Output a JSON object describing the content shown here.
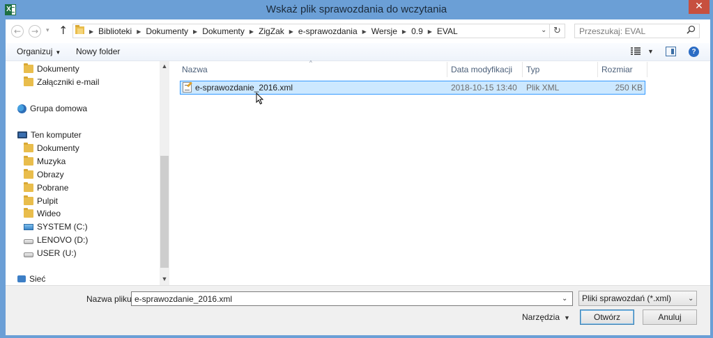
{
  "window": {
    "title": "Wskaż plik sprawozdania do wczytania",
    "close_glyph": "✕",
    "app_icon_letter": "X"
  },
  "nav_buttons": {
    "back": "←",
    "forward": "→",
    "history": "▾",
    "up": "↑"
  },
  "address": {
    "crumbs": [
      "Biblioteki",
      "Dokumenty",
      "Dokumenty",
      "ZigZak",
      "e-sprawozdania",
      "Wersje",
      "0.9",
      "EVAL"
    ],
    "dropdown_glyph": "⌄",
    "refresh_glyph": "↻"
  },
  "search": {
    "placeholder": "Przeszukaj: EVAL",
    "icon": "⚲"
  },
  "toolbar": {
    "organize_label": "Organizuj",
    "organize_caret": "▼",
    "new_folder_label": "Nowy folder",
    "view_caret": "▼",
    "help_glyph": "?"
  },
  "nav": {
    "items": [
      {
        "label": "Dokumenty",
        "icon": "folder-icon"
      },
      {
        "label": "Załączniki e-mail",
        "icon": "folder-icon"
      },
      {
        "label": "Grupa domowa",
        "icon": "homegroup-icon"
      },
      {
        "label": "Ten komputer",
        "icon": "computer-icon"
      },
      {
        "label": "Dokumenty",
        "icon": "documents-folder-icon"
      },
      {
        "label": "Muzyka",
        "icon": "music-folder-icon"
      },
      {
        "label": "Obrazy",
        "icon": "pictures-folder-icon"
      },
      {
        "label": "Pobrane",
        "icon": "downloads-folder-icon"
      },
      {
        "label": "Pulpit",
        "icon": "desktop-folder-icon"
      },
      {
        "label": "Wideo",
        "icon": "videos-folder-icon"
      },
      {
        "label": "SYSTEM (C:)",
        "icon": "system-drive-icon"
      },
      {
        "label": "LENOVO (D:)",
        "icon": "drive-icon"
      },
      {
        "label": "USER (U:)",
        "icon": "drive-icon"
      },
      {
        "label": "Sieć",
        "icon": "network-icon"
      }
    ],
    "scroll_up": "▲",
    "scroll_down": "▼"
  },
  "columns": {
    "name": "Nazwa",
    "date": "Data modyfikacji",
    "type": "Typ",
    "size": "Rozmiar",
    "sort_glyph": "^"
  },
  "files": [
    {
      "name": "e-sprawozdanie_2016.xml",
      "date": "2018-10-15 13:40",
      "type": "Plik XML",
      "size": "250 KB"
    }
  ],
  "bottom": {
    "filename_label": "Nazwa pliku:",
    "filename_value": "e-sprawozdanie_2016.xml",
    "filename_dropdown": "⌄",
    "filetype_value": "Pliki sprawozdań (*.xml)",
    "filetype_caret": "⌄",
    "tools_label": "Narzędzia",
    "tools_caret": "▼",
    "open_label": "Otwórz",
    "cancel_label": "Anuluj"
  },
  "colors": {
    "titlebar": "#6b9fd6",
    "close": "#c7503f",
    "selection_fill": "#cce8ff",
    "selection_border": "#3399ff"
  }
}
